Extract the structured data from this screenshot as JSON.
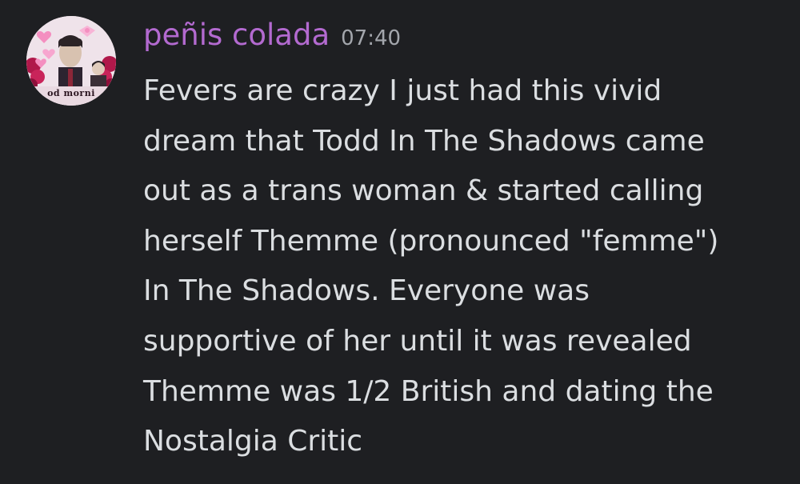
{
  "message": {
    "author": "peñis colada",
    "timestamp": "07:40",
    "avatar": {
      "caption": "od morni"
    },
    "content_lines": [
      "Fevers are crazy I just had this vivid",
      "dream that Todd In The Shadows came",
      "out as a trans woman & started calling",
      "herself Themme (pronounced \"femme\")",
      "In The Shadows. Everyone was",
      "supportive of her until it was revealed",
      "Themme was 1/2 British and dating the",
      "Nostalgia Critic"
    ]
  },
  "colors": {
    "background": "#1e1f22",
    "username": "#b36ad0",
    "timestamp": "#a3a6ac",
    "text": "#dbdee1"
  }
}
